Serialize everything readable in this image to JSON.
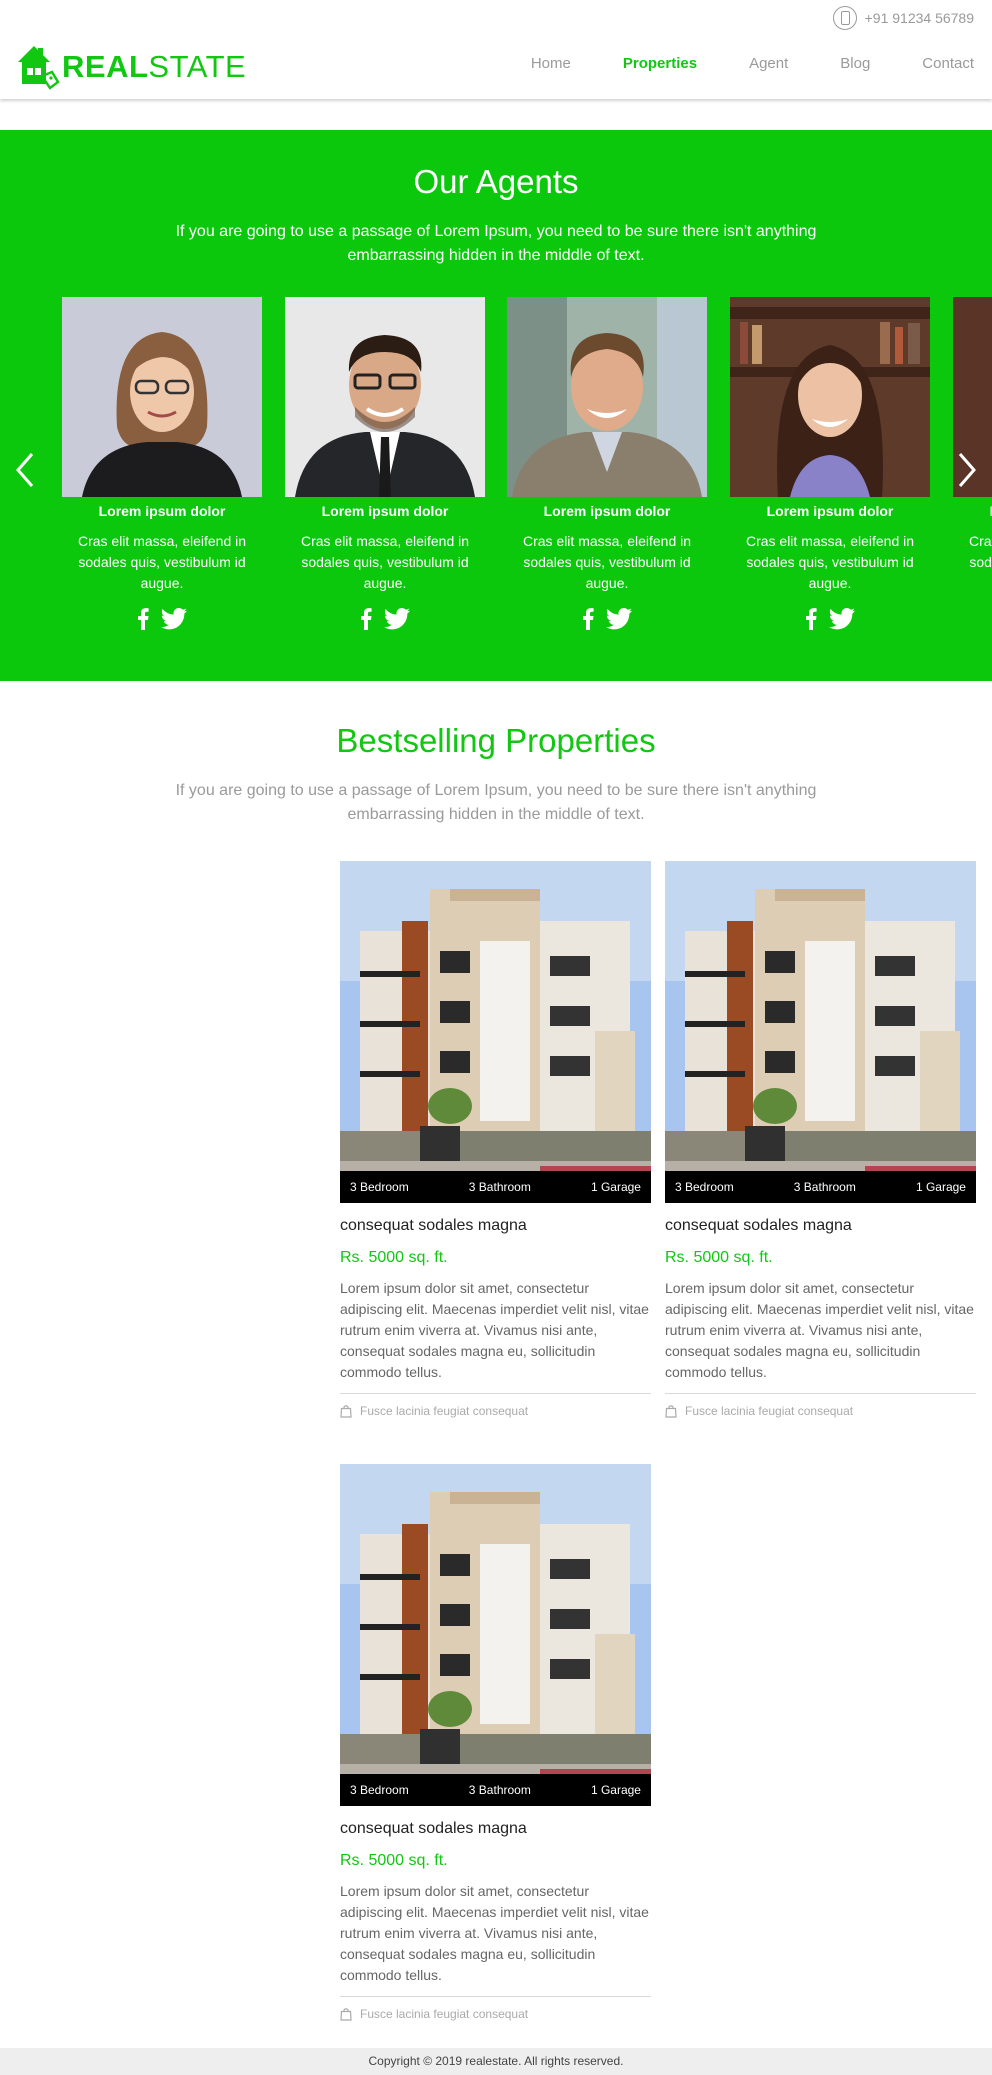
{
  "header": {
    "phone": "+91 91234 56789",
    "logo": {
      "bold": "REAL",
      "light": "STATE"
    },
    "nav": [
      {
        "label": "Home",
        "active": false
      },
      {
        "label": "Properties",
        "active": true
      },
      {
        "label": "Agent",
        "active": false
      },
      {
        "label": "Blog",
        "active": false
      },
      {
        "label": "Contact",
        "active": false
      }
    ]
  },
  "agents": {
    "title": "Our Agents",
    "subtitle": "If you are going to use a passage of Lorem Ipsum, you need to be sure there isn't anything embarrassing hidden in the middle of text.",
    "items": [
      {
        "name": "Lorem ipsum dolor",
        "text": "Cras elit massa, eleifend in sodales quis, vestibulum id augue."
      },
      {
        "name": "Lorem ipsum dolor",
        "text": "Cras elit massa, eleifend in sodales quis, vestibulum id augue."
      },
      {
        "name": "Lorem ipsum dolor",
        "text": "Cras elit massa, eleifend in sodales quis, vestibulum id augue."
      },
      {
        "name": "Lorem ipsum dolor",
        "text": "Cras elit massa, eleifend in sodales quis, vestibulum id augue."
      },
      {
        "name": "Lorem ipsum dolor",
        "text": "Cras elit massa, eleifend in sodales quis, vestibulum id augue."
      }
    ],
    "colors": {
      "background": "#0cc80c"
    }
  },
  "bestselling": {
    "title": "Bestselling Properties",
    "subtitle": "If you are going to use a passage of Lorem Ipsum, you need to be sure there isn't anything embarrassing hidden in the middle of text.",
    "properties": [
      {
        "bedroom": "3 Bedroom",
        "bathroom": "3 Bathroom",
        "garage": "1 Garage",
        "title": "consequat sodales magna",
        "price": "Rs. 5000 sq. ft.",
        "description": "Lorem ipsum dolor sit amet, consectetur adipiscing elit. Maecenas imperdiet velit nisl, vitae rutrum enim viverra at. Vivamus nisi ante, consequat sodales magna eu, sollicitudin commodo tellus.",
        "footer": "Fusce lacinia feugiat consequat"
      },
      {
        "bedroom": "3 Bedroom",
        "bathroom": "3 Bathroom",
        "garage": "1 Garage",
        "title": "consequat sodales magna",
        "price": "Rs. 5000 sq. ft.",
        "description": "Lorem ipsum dolor sit amet, consectetur adipiscing elit. Maecenas imperdiet velit nisl, vitae rutrum enim viverra at. Vivamus nisi ante, consequat sodales magna eu, sollicitudin commodo tellus.",
        "footer": "Fusce lacinia feugiat consequat"
      },
      {
        "bedroom": "3 Bedroom",
        "bathroom": "3 Bathroom",
        "garage": "1 Garage",
        "title": "consequat sodales magna",
        "price": "Rs. 5000 sq. ft.",
        "description": "Lorem ipsum dolor sit amet, consectetur adipiscing elit. Maecenas imperdiet velit nisl, vitae rutrum enim viverra at. Vivamus nisi ante, consequat sodales magna eu, sollicitudin commodo tellus.",
        "footer": "Fusce lacinia feugiat consequat"
      }
    ]
  },
  "footer": {
    "copyright": "Copyright © 2019 realestate. All rights reserved."
  },
  "theme": {
    "accent": "#11c711",
    "footer_bg": "#eeeeee"
  }
}
